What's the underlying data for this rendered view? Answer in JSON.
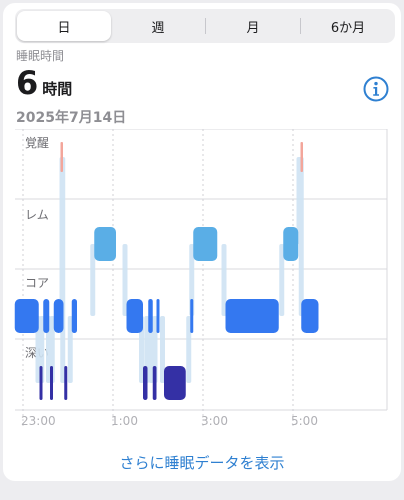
{
  "tabs": [
    {
      "label": "日",
      "active": true
    },
    {
      "label": "週",
      "active": false
    },
    {
      "label": "月",
      "active": false
    },
    {
      "label": "6か月",
      "active": false
    }
  ],
  "summary": {
    "label": "睡眠時間",
    "value": "6",
    "unit": "時間",
    "date": "2025年7月14日"
  },
  "info_icon": "info-circle-icon",
  "more_link": "さらに睡眠データを表示",
  "colors": {
    "awake": "#f3a69b",
    "rem": "#5aaee6",
    "core": "#3478f0",
    "deep": "#3430a5",
    "connector": "#cfe3f3",
    "accent": "#2f80d1"
  },
  "chart_data": {
    "type": "hypnogram",
    "stages": [
      "覚醒",
      "レム",
      "コア",
      "深い"
    ],
    "x_ticks": [
      "23:00",
      "1:00",
      "3:00",
      "5:00"
    ],
    "segments": [
      {
        "stage": "コア",
        "start": "22:49",
        "end": "23:21"
      },
      {
        "stage": "深い",
        "start": "23:22",
        "end": "23:25"
      },
      {
        "stage": "コア",
        "start": "23:27",
        "end": "23:35"
      },
      {
        "stage": "深い",
        "start": "23:36",
        "end": "23:40"
      },
      {
        "stage": "コア",
        "start": "23:41",
        "end": "23:54"
      },
      {
        "stage": "深い",
        "start": "23:55",
        "end": "23:59"
      },
      {
        "stage": "覚醒",
        "start": "23:50",
        "end": "23:52"
      },
      {
        "stage": "コア",
        "start": "0:05",
        "end": "0:12"
      },
      {
        "stage": "レム",
        "start": "0:35",
        "end": "1:04"
      },
      {
        "stage": "コア",
        "start": "1:18",
        "end": "1:40"
      },
      {
        "stage": "深い",
        "start": "1:40",
        "end": "1:46"
      },
      {
        "stage": "コア",
        "start": "1:47",
        "end": "1:53"
      },
      {
        "stage": "深い",
        "start": "1:53",
        "end": "1:58"
      },
      {
        "stage": "コア",
        "start": "1:58",
        "end": "2:01"
      },
      {
        "stage": "深い",
        "start": "2:08",
        "end": "2:37"
      },
      {
        "stage": "コア",
        "start": "2:43",
        "end": "2:47"
      },
      {
        "stage": "レム",
        "start": "2:47",
        "end": "3:19"
      },
      {
        "stage": "コア",
        "start": "3:30",
        "end": "4:41"
      },
      {
        "stage": "レム",
        "start": "4:47",
        "end": "5:07"
      },
      {
        "stage": "覚醒",
        "start": "5:10",
        "end": "5:13"
      },
      {
        "stage": "コア",
        "start": "5:11",
        "end": "5:34"
      }
    ]
  }
}
